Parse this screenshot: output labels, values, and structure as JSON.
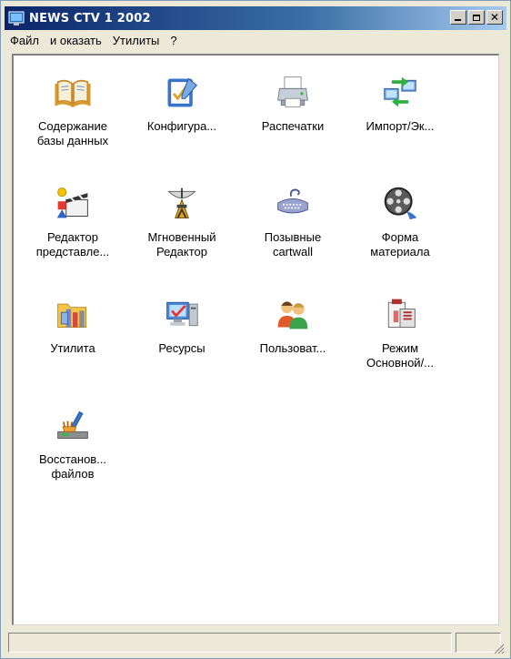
{
  "window": {
    "title": "NEWS CTV  1 2002"
  },
  "menu": [
    "Файл",
    "и оказать",
    "Утилиты",
    "?"
  ],
  "icons": [
    {
      "lines": [
        "Содержание",
        "базы данных"
      ],
      "icon": "open-book-icon"
    },
    {
      "lines": [
        "Конфигура..."
      ],
      "icon": "checklist-icon"
    },
    {
      "lines": [
        "Распечатки"
      ],
      "icon": "printer-icon"
    },
    {
      "lines": [
        "Импорт/Эк..."
      ],
      "icon": "network-transfer-icon"
    },
    {
      "lines": [
        "Редактор",
        "представле..."
      ],
      "icon": "clapperboard-shapes-icon"
    },
    {
      "lines": [
        "Мгновенный",
        "Редактор"
      ],
      "icon": "satellite-dish-icon"
    },
    {
      "lines": [
        "Позывные",
        "cartwall"
      ],
      "icon": "keyboard-icon"
    },
    {
      "lines": [
        "Форма",
        "материала"
      ],
      "icon": "film-reel-icon"
    },
    {
      "lines": [
        "Утилита"
      ],
      "icon": "tools-folder-icon"
    },
    {
      "lines": [
        "Ресурсы"
      ],
      "icon": "computer-resources-icon"
    },
    {
      "lines": [
        "Пользоват..."
      ],
      "icon": "users-icon"
    },
    {
      "lines": [
        "Режим",
        "Основной/..."
      ],
      "icon": "toolbox-icon"
    },
    {
      "lines": [
        "Восстанов...",
        "файлов"
      ],
      "icon": "disk-cleanup-icon"
    }
  ]
}
